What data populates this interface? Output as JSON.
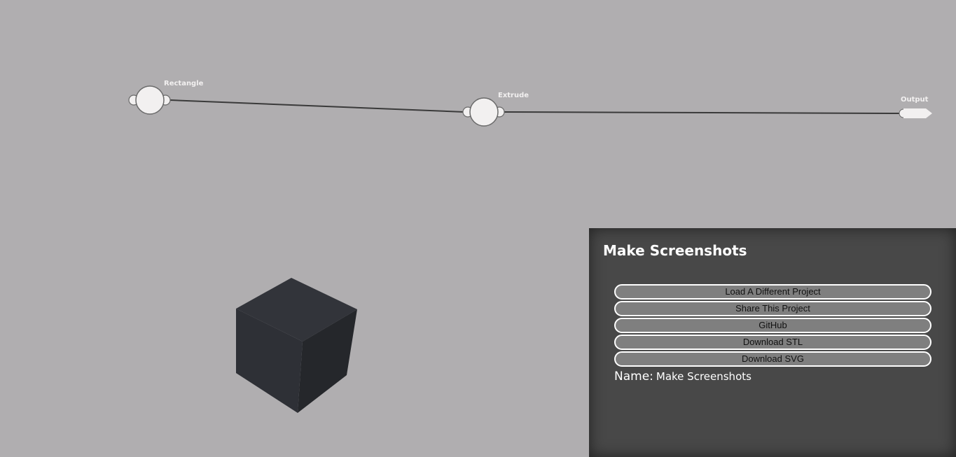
{
  "flow": {
    "nodes": [
      {
        "id": "rectangle",
        "label": "Rectangle"
      },
      {
        "id": "extrude",
        "label": "Extrude"
      },
      {
        "id": "output",
        "label": "Output"
      }
    ]
  },
  "viewer": {
    "object": "cube",
    "colors": {
      "top": "#32343a",
      "left": "#2e3036",
      "right": "#25272b"
    }
  },
  "sidebar": {
    "title": "Make Screenshots",
    "buttons": [
      {
        "label": "Load A Different Project"
      },
      {
        "label": "Share This Project"
      },
      {
        "label": "GitHub"
      },
      {
        "label": "Download STL"
      },
      {
        "label": "Download SVG"
      }
    ],
    "name_label": "Name:",
    "name_value": "Make Screenshots"
  },
  "colors": {
    "background": "#b0aeb0",
    "panel": "#484848",
    "button": "#7f7f7f",
    "node": "#f2f0f0",
    "wire": "#3a3a3a"
  }
}
